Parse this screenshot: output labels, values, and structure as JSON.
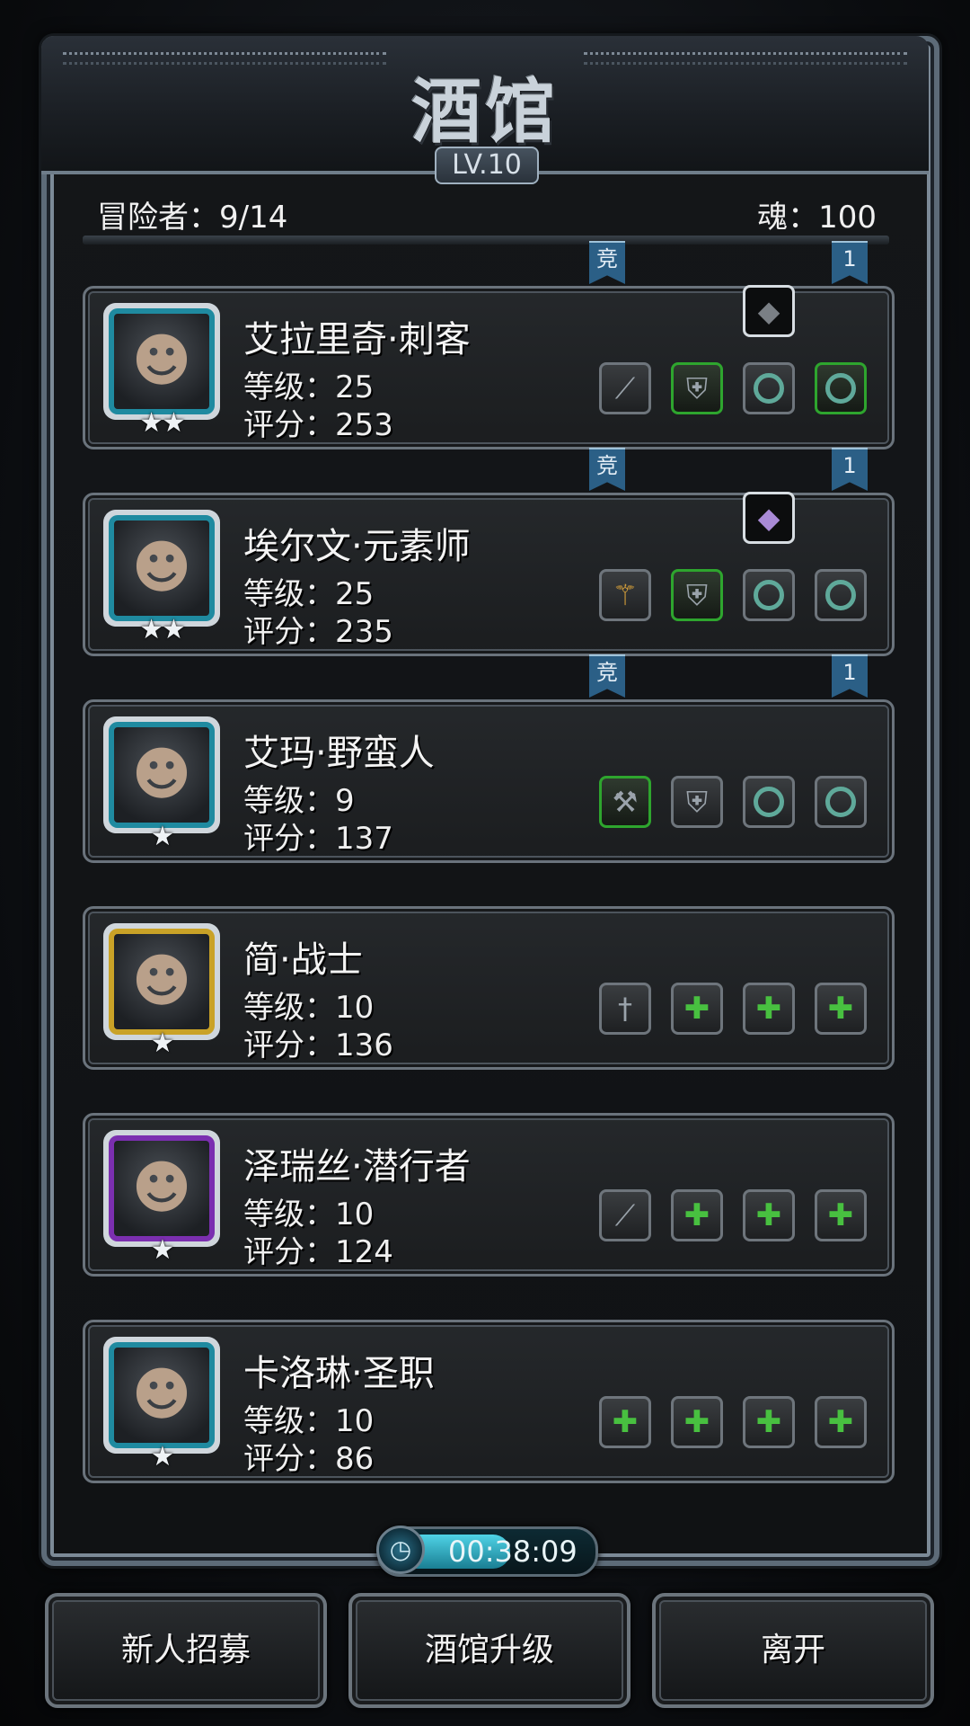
{
  "header": {
    "title": "酒馆",
    "level": "LV.10"
  },
  "stats": {
    "adventurers": "冒险者：9/14",
    "soul": "魂：100"
  },
  "heroes": [
    {
      "name": "艾拉里奇·刺客",
      "level": "等级：25",
      "score": "评分：253",
      "stars": "★★",
      "frame_color": "#1f8aa0",
      "gem": "dark-stone-icon",
      "slots": [
        "dagger-icon",
        "armor-icon",
        "ring-icon",
        "ring-icon"
      ],
      "badges": [
        "竞",
        "1"
      ]
    },
    {
      "name": "埃尔文·元素师",
      "level": "等级：25",
      "score": "评分：235",
      "stars": "★★",
      "frame_color": "#1f8aa0",
      "gem": "amethyst-icon",
      "slots": [
        "staff-icon",
        "armor-icon",
        "ring-icon",
        "ring-icon"
      ],
      "badges": [
        "竞",
        "1"
      ]
    },
    {
      "name": "艾玛·野蛮人",
      "level": "等级：9",
      "score": "评分：137",
      "stars": "★",
      "frame_color": "#1f8aa0",
      "slots": [
        "axe-icon",
        "armor-icon",
        "ring-icon",
        "ring-icon"
      ],
      "badges": [
        "竞",
        "1"
      ]
    },
    {
      "name": "简·战士",
      "level": "等级：10",
      "score": "评分：136",
      "stars": "★",
      "frame_color": "#c9a227",
      "slots": [
        "sword-icon",
        "add-armor-icon",
        "add-ring-icon",
        "add-ring-icon"
      ]
    },
    {
      "name": "泽瑞丝·潜行者",
      "level": "等级：10",
      "score": "评分：124",
      "stars": "★",
      "frame_color": "#7b2fb0",
      "slots": [
        "dagger-icon",
        "add-armor-icon",
        "add-ring-icon",
        "add-ring-icon"
      ]
    },
    {
      "name": "卡洛琳·圣职",
      "level": "等级：10",
      "score": "评分：86",
      "stars": "★",
      "frame_color": "#1f8aa0",
      "slots": [
        "add-mace-icon",
        "add-armor-icon",
        "add-ring-icon",
        "add-ring-icon"
      ]
    }
  ],
  "timer": {
    "time_main": "00:38",
    "time_tail": ":09",
    "progress": 0.55
  },
  "buttons": {
    "recruit": "新人招募",
    "upgrade": "酒馆升级",
    "leave": "离开"
  },
  "colors": {
    "accent": "#1f8aa0",
    "equip_green": "#2ea52e",
    "badge_blue": "#2b5f86"
  }
}
